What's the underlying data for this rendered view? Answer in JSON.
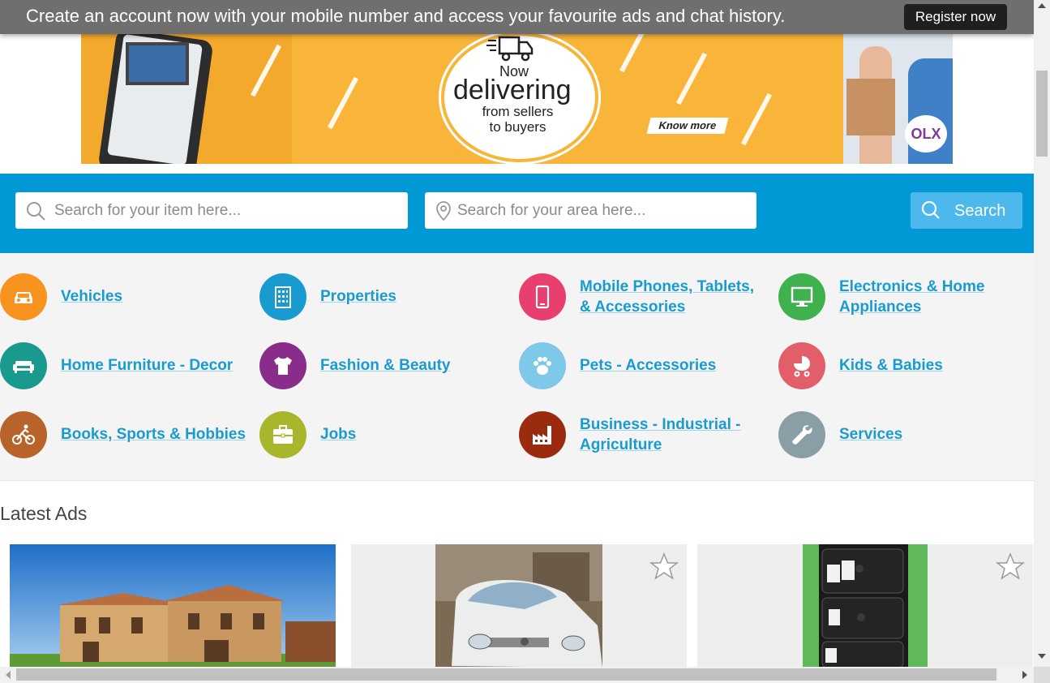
{
  "register_bar": {
    "message": "Create an account now with your mobile number and access your favourite ads and chat history.",
    "button_label": "Register now"
  },
  "banner": {
    "now": "Now",
    "headline": "delivering",
    "sub": "from sellers to buyers",
    "cta": "Know more",
    "brand": "OLX"
  },
  "search": {
    "item_placeholder": "Search for your item here...",
    "area_placeholder": "Search for your area here...",
    "button_label": "Search"
  },
  "colors": {
    "search_band": "#0099d6",
    "link": "#1a9bd0"
  },
  "categories": [
    {
      "label": "Vehicles",
      "icon": "car-icon",
      "color": "#f7931e"
    },
    {
      "label": "Properties",
      "icon": "building-icon",
      "color": "#1a9bd0"
    },
    {
      "label": "Mobile Phones, Tablets, & Accessories",
      "icon": "mobile-phone-icon",
      "color": "#e83f6f"
    },
    {
      "label": "Electronics & Home Appliances",
      "icon": "monitor-icon",
      "color": "#3fb24f"
    },
    {
      "label": "Home Furniture - Decor",
      "icon": "sofa-icon",
      "color": "#1a9a8e"
    },
    {
      "label": "Fashion & Beauty",
      "icon": "tshirt-icon",
      "color": "#8a2d8a"
    },
    {
      "label": "Pets - Accessories",
      "icon": "paw-icon",
      "color": "#7ec8ea"
    },
    {
      "label": "Kids & Babies",
      "icon": "stroller-icon",
      "color": "#e25f6a"
    },
    {
      "label": "Books, Sports & Hobbies",
      "icon": "cyclist-icon",
      "color": "#b8632a"
    },
    {
      "label": "Jobs",
      "icon": "briefcase-icon",
      "color": "#a8b62c"
    },
    {
      "label": "Business - Industrial - Agriculture",
      "icon": "factory-icon",
      "color": "#9b2b0f"
    },
    {
      "label": "Services",
      "icon": "wrench-icon",
      "color": "#8a9ea6"
    }
  ],
  "latest_ads": {
    "title": "Latest Ads",
    "cards": [
      {
        "image": "villa-photo",
        "favorite_icon": false
      },
      {
        "image": "white-car-photo",
        "favorite_icon": true
      },
      {
        "image": "phones-photo",
        "favorite_icon": true
      }
    ]
  }
}
